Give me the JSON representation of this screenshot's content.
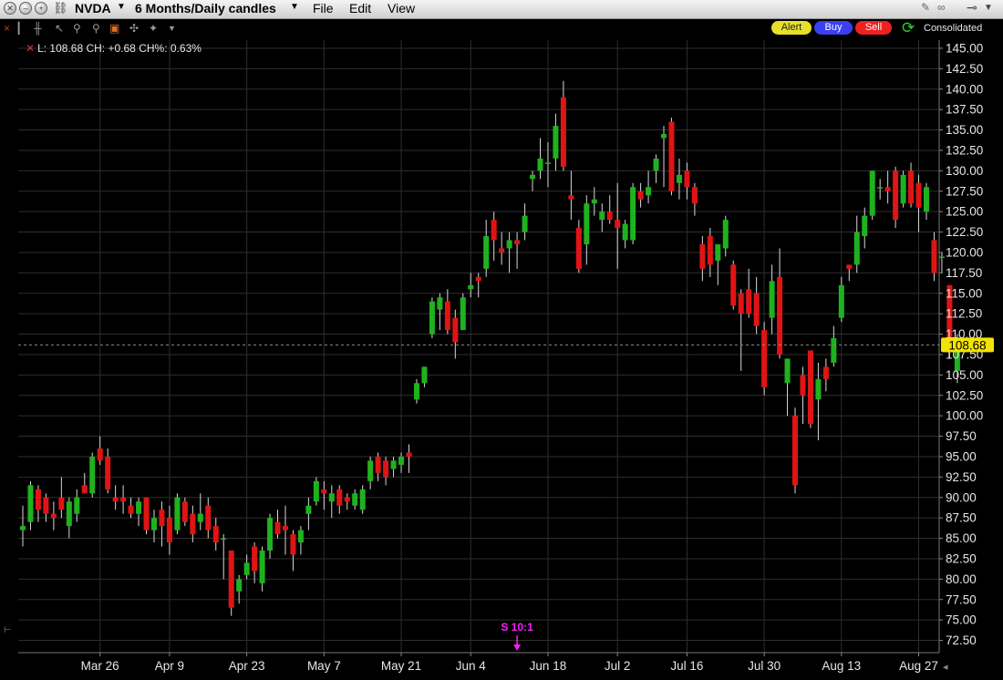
{
  "titlebar": {
    "symbol": "NVDA",
    "period": "6 Months/Daily candles",
    "menus": [
      {
        "label": "File"
      },
      {
        "label": "Edit"
      },
      {
        "label": "View"
      }
    ]
  },
  "toolbar": {
    "icons": [
      "close-icon",
      "bar-chart-icon",
      "candlestick-icon",
      "pointer-icon",
      "zoom-in-icon",
      "zoom-out-icon",
      "orange-candle-icon",
      "crosshair-icon",
      "compare-icon",
      "dropdown-arrow-icon"
    ],
    "buttons": [
      {
        "label": "Alert",
        "color": "#e6e02a"
      },
      {
        "label": "Buy",
        "color": "#3a3ff0"
      },
      {
        "label": "Sell",
        "color": "#ee2222"
      }
    ],
    "consolidated_label": "Consolidated"
  },
  "readout": {
    "close_label": "L:",
    "close_value": "108.68",
    "change_label": "CH:",
    "change_value": "+0.68",
    "change_pct_label": "CH%:",
    "change_pct_value": "0.63%"
  },
  "colors": {
    "up": "#1fb21f",
    "down": "#e01414",
    "grid": "#2e2e2e",
    "last_price_bg": "#f2e400",
    "split_marker": "#ff1aff"
  },
  "chart_data": {
    "type": "candlestick",
    "title": "",
    "xlabel": "",
    "ylabel": "",
    "ylim": [
      71,
      146
    ],
    "grid": true,
    "y_ticks": [
      145.0,
      142.5,
      140.0,
      137.5,
      135.0,
      132.5,
      130.0,
      127.5,
      125.0,
      122.5,
      120.0,
      117.5,
      115.0,
      112.5,
      110.0,
      107.5,
      105.0,
      102.5,
      100.0,
      97.5,
      95.0,
      92.5,
      90.0,
      87.5,
      85.0,
      82.5,
      80.0,
      77.5,
      75.0,
      72.5
    ],
    "x_tick_labels": [
      {
        "label": "Mar 26",
        "index": 10
      },
      {
        "label": "Apr 9",
        "index": 19
      },
      {
        "label": "Apr 23",
        "index": 29
      },
      {
        "label": "May 7",
        "index": 39
      },
      {
        "label": "May 21",
        "index": 49
      },
      {
        "label": "Jun 4",
        "index": 58
      },
      {
        "label": "Jun 18",
        "index": 68
      },
      {
        "label": "Jul 2",
        "index": 77
      },
      {
        "label": "Jul 16",
        "index": 86
      },
      {
        "label": "Jul 30",
        "index": 96
      },
      {
        "label": "Aug 13",
        "index": 106
      },
      {
        "label": "Aug 27",
        "index": 116
      }
    ],
    "last_price": "108.68",
    "last_price_value": 108.68,
    "split_annotation": {
      "label": "S 10:1",
      "index": 64
    },
    "candles": [
      {
        "o": 86.0,
        "h": 89.0,
        "l": 84.0,
        "c": 86.5
      },
      {
        "o": 87.0,
        "h": 92.0,
        "l": 86.0,
        "c": 91.5
      },
      {
        "o": 91.0,
        "h": 91.5,
        "l": 87.0,
        "c": 88.5
      },
      {
        "o": 90.0,
        "h": 90.5,
        "l": 87.0,
        "c": 88.0
      },
      {
        "o": 88.0,
        "h": 89.5,
        "l": 86.0,
        "c": 87.5
      },
      {
        "o": 90.0,
        "h": 92.5,
        "l": 87.5,
        "c": 88.5
      },
      {
        "o": 86.5,
        "h": 90.0,
        "l": 85.0,
        "c": 89.5
      },
      {
        "o": 88.0,
        "h": 91.0,
        "l": 87.0,
        "c": 90.0
      },
      {
        "o": 91.5,
        "h": 93.0,
        "l": 90.5,
        "c": 90.5
      },
      {
        "o": 90.5,
        "h": 95.5,
        "l": 90.0,
        "c": 95.0
      },
      {
        "o": 96.0,
        "h": 97.5,
        "l": 94.0,
        "c": 94.5
      },
      {
        "o": 95.0,
        "h": 96.0,
        "l": 90.5,
        "c": 91.0
      },
      {
        "o": 90.0,
        "h": 91.5,
        "l": 88.5,
        "c": 89.5
      },
      {
        "o": 90.0,
        "h": 91.5,
        "l": 88.0,
        "c": 89.5
      },
      {
        "o": 89.0,
        "h": 90.0,
        "l": 87.5,
        "c": 88.0
      },
      {
        "o": 88.0,
        "h": 90.0,
        "l": 86.5,
        "c": 89.5
      },
      {
        "o": 90.0,
        "h": 90.0,
        "l": 85.5,
        "c": 86.0
      },
      {
        "o": 86.0,
        "h": 88.5,
        "l": 84.5,
        "c": 87.5
      },
      {
        "o": 88.5,
        "h": 89.5,
        "l": 84.0,
        "c": 86.5
      },
      {
        "o": 87.5,
        "h": 89.0,
        "l": 83.0,
        "c": 84.5
      },
      {
        "o": 86.0,
        "h": 90.5,
        "l": 85.5,
        "c": 90.0
      },
      {
        "o": 89.5,
        "h": 90.0,
        "l": 86.5,
        "c": 87.0
      },
      {
        "o": 88.0,
        "h": 89.0,
        "l": 84.5,
        "c": 85.5
      },
      {
        "o": 87.0,
        "h": 90.5,
        "l": 86.0,
        "c": 88.0
      },
      {
        "o": 89.0,
        "h": 90.0,
        "l": 85.0,
        "c": 86.0
      },
      {
        "o": 86.5,
        "h": 87.5,
        "l": 83.5,
        "c": 84.5
      },
      {
        "o": 85.0,
        "h": 85.5,
        "l": 80.0,
        "c": 85.0
      },
      {
        "o": 83.5,
        "h": 83.5,
        "l": 75.5,
        "c": 76.5
      },
      {
        "o": 78.5,
        "h": 80.5,
        "l": 77.0,
        "c": 80.0
      },
      {
        "o": 80.5,
        "h": 83.0,
        "l": 80.0,
        "c": 82.0
      },
      {
        "o": 84.0,
        "h": 84.5,
        "l": 79.5,
        "c": 81.0
      },
      {
        "o": 79.5,
        "h": 84.0,
        "l": 78.5,
        "c": 83.5
      },
      {
        "o": 83.5,
        "h": 88.0,
        "l": 82.5,
        "c": 87.5
      },
      {
        "o": 87.0,
        "h": 88.5,
        "l": 85.0,
        "c": 85.5
      },
      {
        "o": 86.5,
        "h": 89.0,
        "l": 83.0,
        "c": 86.0
      },
      {
        "o": 85.5,
        "h": 86.0,
        "l": 81.0,
        "c": 83.0
      },
      {
        "o": 84.5,
        "h": 86.5,
        "l": 83.0,
        "c": 86.0
      },
      {
        "o": 88.0,
        "h": 90.0,
        "l": 86.0,
        "c": 89.0
      },
      {
        "o": 89.5,
        "h": 92.5,
        "l": 89.0,
        "c": 92.0
      },
      {
        "o": 91.0,
        "h": 92.0,
        "l": 88.5,
        "c": 90.5
      },
      {
        "o": 89.5,
        "h": 91.5,
        "l": 87.5,
        "c": 90.5
      },
      {
        "o": 91.0,
        "h": 91.5,
        "l": 88.0,
        "c": 89.0
      },
      {
        "o": 90.0,
        "h": 90.5,
        "l": 88.5,
        "c": 89.5
      },
      {
        "o": 89.0,
        "h": 91.0,
        "l": 88.5,
        "c": 90.5
      },
      {
        "o": 88.5,
        "h": 91.5,
        "l": 88.0,
        "c": 91.0
      },
      {
        "o": 92.0,
        "h": 95.0,
        "l": 91.0,
        "c": 94.5
      },
      {
        "o": 95.0,
        "h": 95.5,
        "l": 92.0,
        "c": 93.0
      },
      {
        "o": 94.5,
        "h": 95.0,
        "l": 91.5,
        "c": 92.5
      },
      {
        "o": 93.5,
        "h": 95.0,
        "l": 92.5,
        "c": 94.5
      },
      {
        "o": 94.0,
        "h": 95.5,
        "l": 93.0,
        "c": 95.0
      },
      {
        "o": 95.5,
        "h": 96.5,
        "l": 93.0,
        "c": 95.0
      },
      {
        "o": 102.0,
        "h": 104.5,
        "l": 101.5,
        "c": 104.0
      },
      {
        "o": 104.0,
        "h": 106.0,
        "l": 103.5,
        "c": 106.0
      },
      {
        "o": 110.0,
        "h": 114.5,
        "l": 109.5,
        "c": 114.0
      },
      {
        "o": 113.0,
        "h": 115.0,
        "l": 110.5,
        "c": 114.5
      },
      {
        "o": 114.0,
        "h": 115.5,
        "l": 110.0,
        "c": 110.5
      },
      {
        "o": 112.0,
        "h": 113.0,
        "l": 107.0,
        "c": 109.0
      },
      {
        "o": 110.5,
        "h": 115.0,
        "l": 110.5,
        "c": 114.5
      },
      {
        "o": 115.5,
        "h": 117.5,
        "l": 114.5,
        "c": 116.0
      },
      {
        "o": 117.0,
        "h": 117.5,
        "l": 114.5,
        "c": 116.5
      },
      {
        "o": 118.0,
        "h": 124.0,
        "l": 117.0,
        "c": 122.0
      },
      {
        "o": 124.0,
        "h": 125.0,
        "l": 119.0,
        "c": 121.5
      },
      {
        "o": 120.5,
        "h": 122.5,
        "l": 118.5,
        "c": 120.0
      },
      {
        "o": 120.5,
        "h": 122.5,
        "l": 117.5,
        "c": 121.5
      },
      {
        "o": 121.5,
        "h": 122.5,
        "l": 118.0,
        "c": 121.0
      },
      {
        "o": 122.5,
        "h": 126.0,
        "l": 121.5,
        "c": 124.5
      },
      {
        "o": 129.0,
        "h": 130.0,
        "l": 127.5,
        "c": 129.5
      },
      {
        "o": 130.0,
        "h": 134.0,
        "l": 129.0,
        "c": 131.5
      },
      {
        "o": 131.0,
        "h": 133.5,
        "l": 128.0,
        "c": 131.0
      },
      {
        "o": 131.5,
        "h": 137.0,
        "l": 130.0,
        "c": 135.5
      },
      {
        "o": 139.0,
        "h": 141.0,
        "l": 130.0,
        "c": 130.5
      },
      {
        "o": 127.0,
        "h": 130.0,
        "l": 124.0,
        "c": 126.5
      },
      {
        "o": 123.0,
        "h": 124.0,
        "l": 117.5,
        "c": 118.0
      },
      {
        "o": 121.0,
        "h": 127.0,
        "l": 118.5,
        "c": 126.0
      },
      {
        "o": 126.0,
        "h": 128.0,
        "l": 124.5,
        "c": 126.5
      },
      {
        "o": 124.0,
        "h": 126.0,
        "l": 122.5,
        "c": 125.0
      },
      {
        "o": 125.0,
        "h": 127.0,
        "l": 123.5,
        "c": 124.0
      },
      {
        "o": 124.0,
        "h": 128.5,
        "l": 118.0,
        "c": 123.0
      },
      {
        "o": 121.5,
        "h": 124.0,
        "l": 120.5,
        "c": 123.5
      },
      {
        "o": 121.5,
        "h": 128.5,
        "l": 121.0,
        "c": 128.0
      },
      {
        "o": 127.5,
        "h": 128.5,
        "l": 125.5,
        "c": 126.5
      },
      {
        "o": 127.0,
        "h": 130.0,
        "l": 126.0,
        "c": 128.0
      },
      {
        "o": 130.0,
        "h": 132.0,
        "l": 128.5,
        "c": 131.5
      },
      {
        "o": 134.0,
        "h": 135.5,
        "l": 128.0,
        "c": 134.5
      },
      {
        "o": 136.0,
        "h": 136.5,
        "l": 127.0,
        "c": 127.5
      },
      {
        "o": 128.5,
        "h": 131.5,
        "l": 126.5,
        "c": 129.5
      },
      {
        "o": 130.0,
        "h": 131.0,
        "l": 126.5,
        "c": 128.0
      },
      {
        "o": 128.0,
        "h": 128.5,
        "l": 124.5,
        "c": 126.0
      },
      {
        "o": 121.0,
        "h": 122.0,
        "l": 116.5,
        "c": 118.0
      },
      {
        "o": 122.0,
        "h": 123.0,
        "l": 117.0,
        "c": 118.5
      },
      {
        "o": 119.0,
        "h": 121.0,
        "l": 116.0,
        "c": 121.0
      },
      {
        "o": 120.5,
        "h": 124.5,
        "l": 119.5,
        "c": 124.0
      },
      {
        "o": 118.5,
        "h": 119.0,
        "l": 113.0,
        "c": 113.5
      },
      {
        "o": 115.0,
        "h": 115.5,
        "l": 105.5,
        "c": 112.5
      },
      {
        "o": 115.5,
        "h": 118.0,
        "l": 112.0,
        "c": 112.5
      },
      {
        "o": 115.0,
        "h": 117.0,
        "l": 110.0,
        "c": 111.0
      },
      {
        "o": 110.5,
        "h": 111.5,
        "l": 102.5,
        "c": 103.5
      },
      {
        "o": 112.0,
        "h": 118.5,
        "l": 110.0,
        "c": 116.5
      },
      {
        "o": 117.0,
        "h": 120.5,
        "l": 107.0,
        "c": 107.5
      },
      {
        "o": 104.0,
        "h": 106.0,
        "l": 100.0,
        "c": 107.0
      },
      {
        "o": 100.0,
        "h": 101.0,
        "l": 90.5,
        "c": 91.5
      },
      {
        "o": 105.0,
        "h": 106.0,
        "l": 99.0,
        "c": 102.5
      },
      {
        "o": 108.0,
        "h": 108.0,
        "l": 98.5,
        "c": 99.0
      },
      {
        "o": 102.0,
        "h": 106.5,
        "l": 97.0,
        "c": 104.5
      },
      {
        "o": 106.0,
        "h": 107.0,
        "l": 103.0,
        "c": 104.5
      },
      {
        "o": 106.5,
        "h": 111.0,
        "l": 106.0,
        "c": 109.5
      },
      {
        "o": 112.0,
        "h": 117.0,
        "l": 111.5,
        "c": 116.0
      },
      {
        "o": 118.5,
        "h": 118.5,
        "l": 116.5,
        "c": 118.0
      },
      {
        "o": 118.5,
        "h": 124.5,
        "l": 117.5,
        "c": 122.5
      },
      {
        "o": 122.0,
        "h": 125.5,
        "l": 120.5,
        "c": 124.5
      },
      {
        "o": 124.5,
        "h": 130.0,
        "l": 124.0,
        "c": 130.0
      },
      {
        "o": 128.0,
        "h": 129.0,
        "l": 126.5,
        "c": 128.0
      },
      {
        "o": 128.0,
        "h": 130.0,
        "l": 126.0,
        "c": 127.5
      },
      {
        "o": 130.0,
        "h": 130.5,
        "l": 123.0,
        "c": 124.0
      },
      {
        "o": 126.0,
        "h": 130.0,
        "l": 125.5,
        "c": 129.5
      },
      {
        "o": 130.0,
        "h": 131.0,
        "l": 125.5,
        "c": 126.0
      },
      {
        "o": 128.5,
        "h": 129.5,
        "l": 122.5,
        "c": 125.5
      },
      {
        "o": 125.0,
        "h": 128.5,
        "l": 124.0,
        "c": 128.0
      },
      {
        "o": 121.5,
        "h": 122.5,
        "l": 116.5,
        "c": 117.5
      },
      {
        "o": 119.5,
        "h": 120.0,
        "l": 117.5,
        "c": 119.5
      },
      {
        "o": 116.0,
        "h": 116.0,
        "l": 107.0,
        "c": 108.0
      },
      {
        "o": 105.5,
        "h": 110.0,
        "l": 104.0,
        "c": 108.5
      }
    ]
  }
}
